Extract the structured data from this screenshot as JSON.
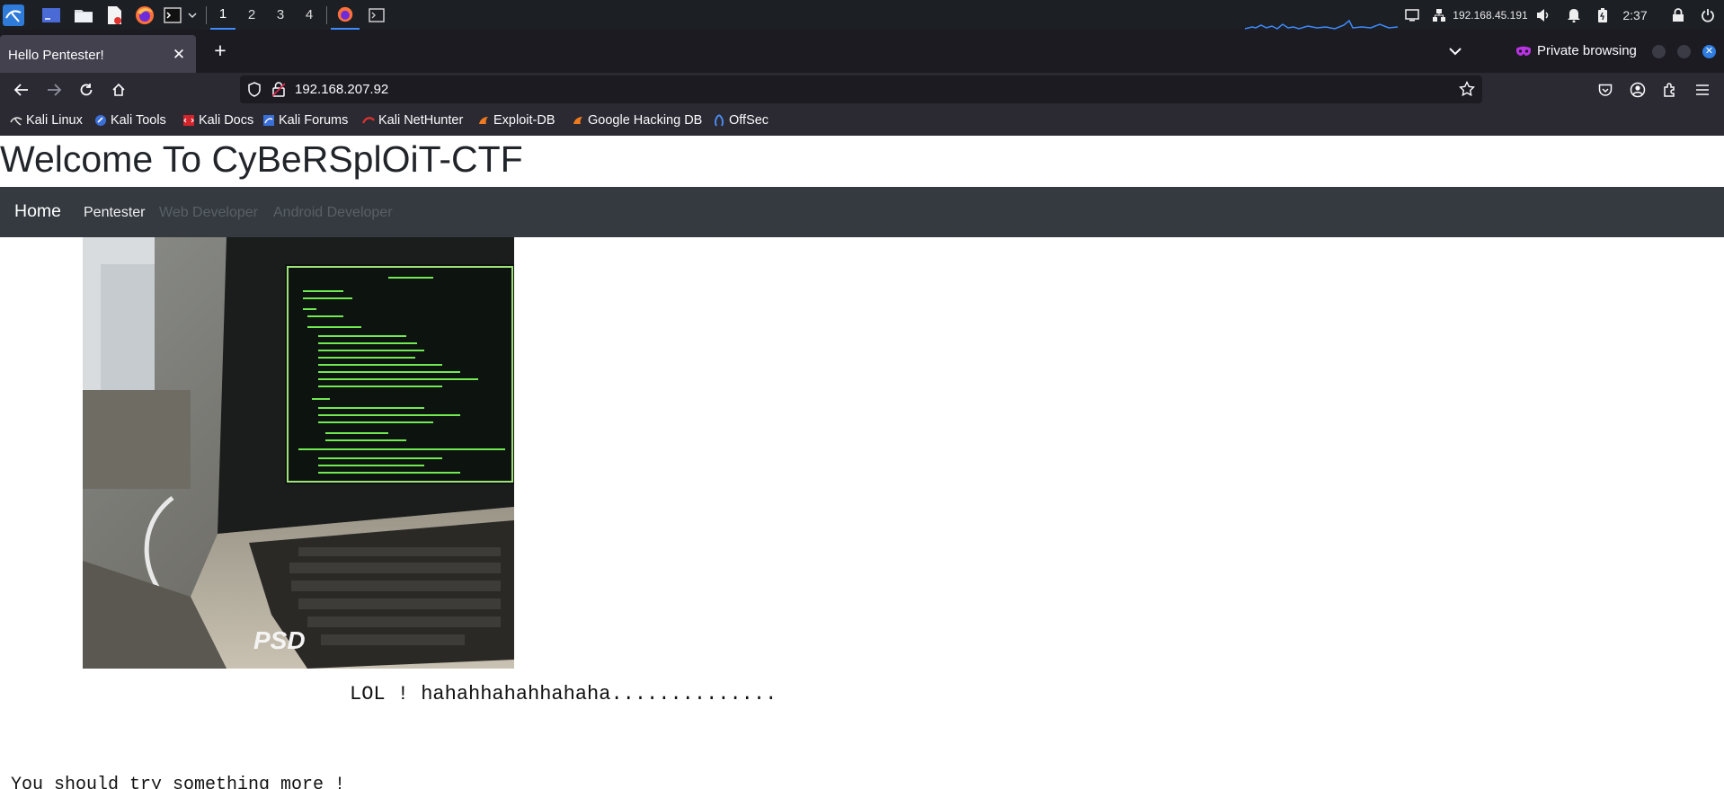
{
  "taskbar": {
    "workspaces": [
      "1",
      "2",
      "3",
      "4"
    ],
    "ip": "192.168.45.191",
    "clock": "2:37",
    "icons": [
      "kali-menu-icon",
      "show-desktop-icon",
      "file-manager-icon",
      "text-editor-icon",
      "firefox-icon",
      "terminal-icon",
      "chevron-down-icon",
      "firefox-window-icon",
      "terminal-window-icon",
      "monitor-icon",
      "network-icon",
      "volume-icon",
      "notification-bell-icon",
      "battery-icon",
      "lock-icon",
      "power-icon"
    ]
  },
  "browser": {
    "tab_title": "Hello Pentester!",
    "private_label": "Private browsing",
    "url": "192.168.207.92",
    "bookmarks": [
      "Kali Linux",
      "Kali Tools",
      "Kali Docs",
      "Kali Forums",
      "Kali NetHunter",
      "Exploit-DB",
      "Google Hacking DB",
      "OffSec"
    ]
  },
  "page": {
    "heading": "Welcome To CyBeRSplOiT-CTF",
    "nav": {
      "brand": "Home",
      "links": [
        "Pentester",
        "Web Developer",
        "Android Developer"
      ]
    },
    "image_watermark": "PSD",
    "lol_text": "LOL ! hahahhahahhahaha..............",
    "try_text": "You should try something more !"
  },
  "colors": {
    "panel_bg": "#1c1f24",
    "tabstrip_bg": "#1c1b22",
    "toolbar_bg": "#2b2a33",
    "site_nav_bg": "#343a40",
    "accent": "#3d8bfd",
    "terminal_green": "#7dff5a"
  }
}
